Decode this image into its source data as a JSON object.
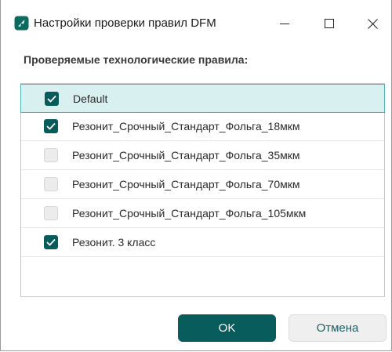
{
  "window": {
    "title": "Настройки проверки правил DFM",
    "icon": "dfm-app-icon",
    "controls": [
      "minimize-icon",
      "maximize-icon",
      "close-icon"
    ]
  },
  "section": {
    "label": "Проверяемые технологические правила:"
  },
  "rules": [
    {
      "label": "Default",
      "checked": true,
      "selected": true
    },
    {
      "label": "Резонит_Срочный_Стандарт_Фольга_18мкм",
      "checked": true,
      "selected": false
    },
    {
      "label": "Резонит_Срочный_Стандарт_Фольга_35мкм",
      "checked": false,
      "selected": false
    },
    {
      "label": "Резонит_Срочный_Стандарт_Фольга_70мкм",
      "checked": false,
      "selected": false
    },
    {
      "label": "Резонит_Срочный_Стандарт_Фольга_105мкм",
      "checked": false,
      "selected": false
    },
    {
      "label": "Резонит. 3 класс",
      "checked": true,
      "selected": false
    }
  ],
  "buttons": {
    "ok_label": "OK",
    "cancel_label": "Отмена"
  },
  "colors": {
    "accent": "#095c5c",
    "selected_row_bg": "#d9f0f0",
    "selected_row_border": "#4fb5b5",
    "cancel_text": "#1f5f64"
  }
}
